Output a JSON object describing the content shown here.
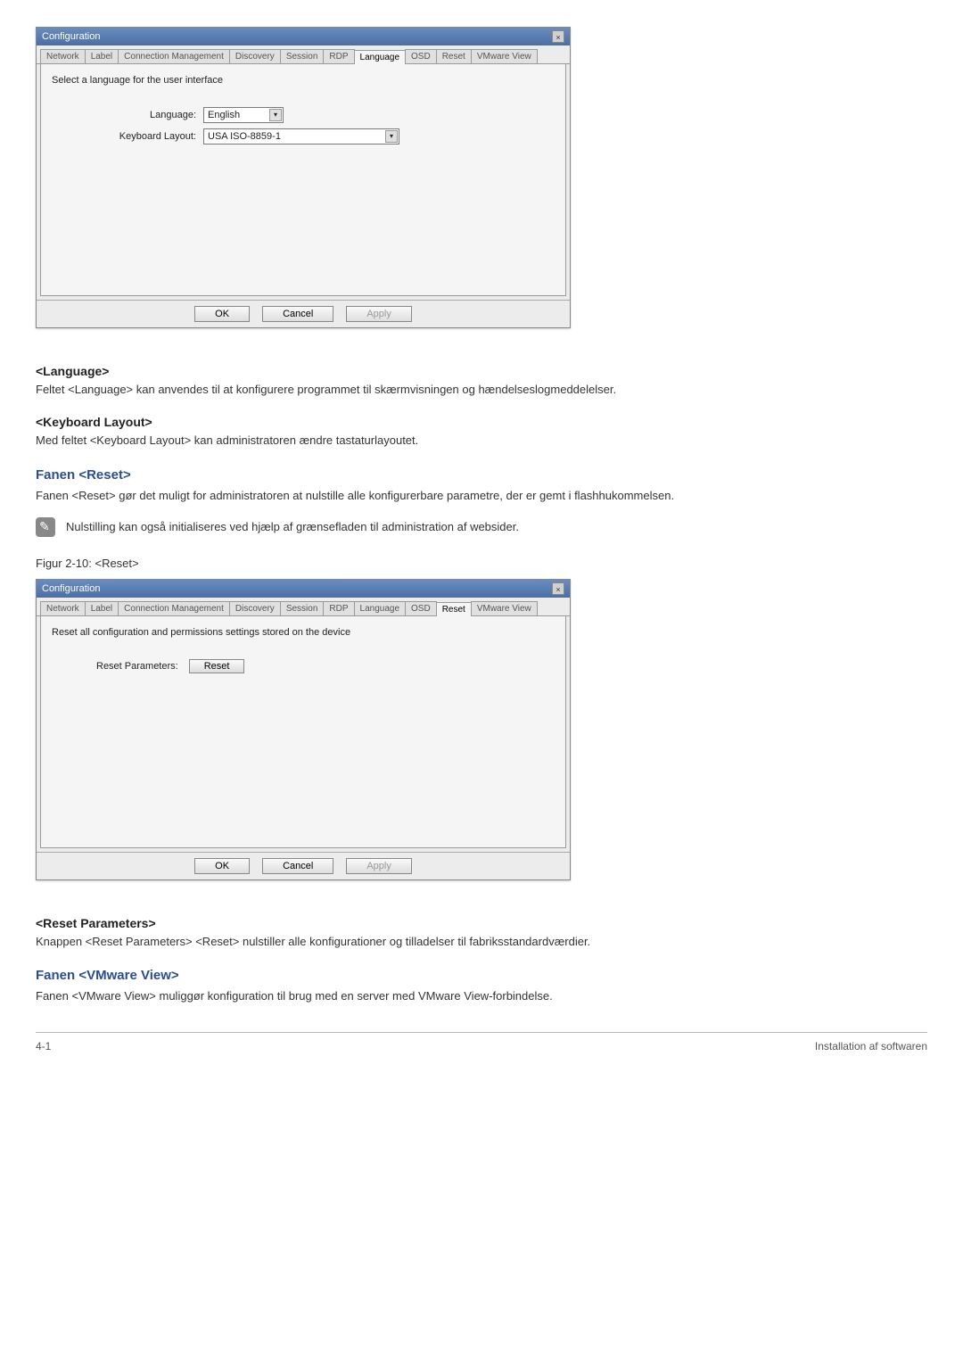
{
  "dialog1": {
    "title": "Configuration",
    "tabs": [
      "Network",
      "Label",
      "Connection Management",
      "Discovery",
      "Session",
      "RDP",
      "Language",
      "OSD",
      "Reset",
      "VMware View"
    ],
    "active_tab": "Language",
    "panel_heading": "Select a language for the user interface",
    "field_language_label": "Language:",
    "field_language_value": "English",
    "field_keyboard_label": "Keyboard Layout:",
    "field_keyboard_value": "USA ISO-8859-1",
    "btn_ok": "OK",
    "btn_cancel": "Cancel",
    "btn_apply": "Apply"
  },
  "sec_language": {
    "heading": "<Language>",
    "body": "Feltet <Language> kan anvendes til at konfigurere programmet til skærmvisningen og hændelseslogmeddelelser."
  },
  "sec_keyboard": {
    "heading": "<Keyboard Layout>",
    "body": "Med feltet <Keyboard Layout> kan administratoren ændre tastaturlayoutet."
  },
  "sec_reset": {
    "heading": "Fanen <Reset>",
    "body": "Fanen <Reset> gør det muligt for administratoren at nulstille alle konfigurerbare parametre, der er gemt i flashhukommelsen.",
    "note": "Nulstilling kan også initialiseres ved hjælp af grænsefladen til administration af websider."
  },
  "figure2": {
    "caption": "Figur 2-10: <Reset>"
  },
  "dialog2": {
    "title": "Configuration",
    "tabs": [
      "Network",
      "Label",
      "Connection Management",
      "Discovery",
      "Session",
      "RDP",
      "Language",
      "OSD",
      "Reset",
      "VMware View"
    ],
    "active_tab": "Reset",
    "panel_heading": "Reset all configuration and permissions settings stored on the device",
    "reset_label": "Reset Parameters:",
    "reset_button": "Reset",
    "btn_ok": "OK",
    "btn_cancel": "Cancel",
    "btn_apply": "Apply"
  },
  "sec_reset_params": {
    "heading": "<Reset Parameters>",
    "body": "Knappen <Reset Parameters> <Reset> nulstiller alle konfigurationer og tilladelser til fabriksstandardværdier."
  },
  "sec_vmware": {
    "heading": "Fanen <VMware View>",
    "body": "Fanen <VMware View> muliggør konfiguration til brug med en server med VMware View-forbindelse."
  },
  "footer": {
    "left": "4-1",
    "right": "Installation af softwaren"
  }
}
